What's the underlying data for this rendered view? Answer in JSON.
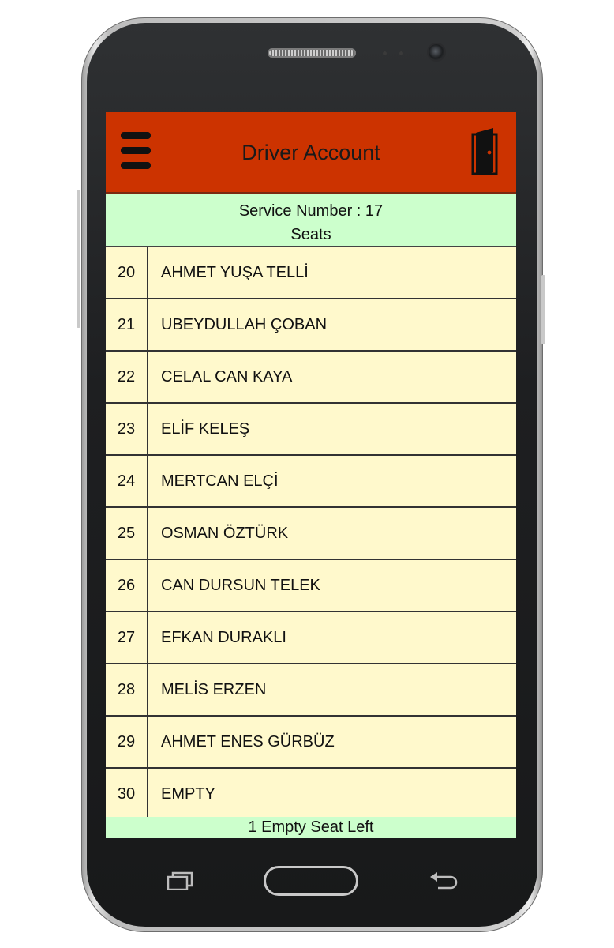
{
  "header": {
    "title": "Driver Account",
    "menu_icon": "hamburger-menu-icon",
    "logout_icon": "door-exit-icon"
  },
  "info": {
    "service_line": "Service Number : 17",
    "seats_line": "Seats"
  },
  "seats": [
    {
      "number": "20",
      "name": "AHMET YUŞA TELLİ"
    },
    {
      "number": "21",
      "name": "UBEYDULLAH ÇOBAN"
    },
    {
      "number": "22",
      "name": "CELAL CAN KAYA"
    },
    {
      "number": "23",
      "name": "ELİF KELEŞ"
    },
    {
      "number": "24",
      "name": "MERTCAN ELÇİ"
    },
    {
      "number": "25",
      "name": "OSMAN ÖZTÜRK"
    },
    {
      "number": "26",
      "name": "CAN DURSUN TELEK"
    },
    {
      "number": "27",
      "name": "EFKAN DURAKLI"
    },
    {
      "number": "28",
      "name": "MELİS ERZEN"
    },
    {
      "number": "29",
      "name": "AHMET ENES GÜRBÜZ"
    },
    {
      "number": "30",
      "name": "EMPTY"
    }
  ],
  "footer": {
    "status": "1 Empty Seat Left"
  },
  "colors": {
    "appbar": "#cc3300",
    "info_bg": "#ccffcc",
    "list_bg": "#fff9cc"
  }
}
